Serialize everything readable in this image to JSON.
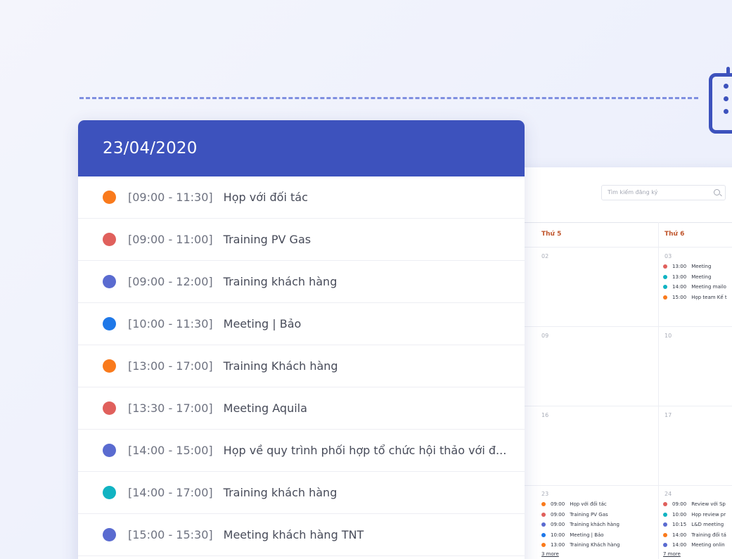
{
  "colors": {
    "primary": "#3d52bd",
    "orange": "#f97a1c",
    "red": "#e0605c",
    "indigo": "#5a6bd0",
    "blue": "#1f78e8",
    "teal": "#11b3c2"
  },
  "agenda": {
    "date": "23/04/2020",
    "items": [
      {
        "time": "[09:00 - 11:30]",
        "title": "Họp với đối tác",
        "color": "#f97a1c"
      },
      {
        "time": "[09:00 - 11:00]",
        "title": "Training PV Gas",
        "color": "#e0605c"
      },
      {
        "time": "[09:00 - 12:00]",
        "title": "Training khách hàng",
        "color": "#5a6bd0"
      },
      {
        "time": "[10:00 - 11:30]",
        "title": "Meeting | Bảo",
        "color": "#1f78e8"
      },
      {
        "time": "[13:00 - 17:00]",
        "title": "Training Khách hàng",
        "color": "#f97a1c"
      },
      {
        "time": "[13:30 - 17:00]",
        "title": "Meeting Aquila",
        "color": "#e0605c"
      },
      {
        "time": "[14:00 - 15:00]",
        "title": "Họp về quy trình phối hợp tổ chức hội thảo với đ...",
        "color": "#5a6bd0"
      },
      {
        "time": "[14:00 - 17:00]",
        "title": "Training khách hàng",
        "color": "#11b3c2"
      },
      {
        "time": "[15:00 - 15:30]",
        "title": "Meeting khách hàng TNT",
        "color": "#5a6bd0"
      }
    ]
  },
  "calendar": {
    "search_placeholder": "Tìm kiếm đăng ký",
    "day_headers": [
      "Thứ 5",
      "Thứ 6"
    ],
    "cells": {
      "r1c1": "02",
      "r1c2": "03",
      "r2c1": "09",
      "r2c2": "10",
      "r3c1": "16",
      "r3c2": "17",
      "r4c1": "23",
      "r4c2": "24"
    },
    "events_03": [
      {
        "time": "13:00",
        "title": "Meeting",
        "color": "#e0605c"
      },
      {
        "time": "13:00",
        "title": "Meeting",
        "color": "#11b3c2"
      },
      {
        "time": "14:00",
        "title": "Meeting mailo",
        "color": "#11b3c2"
      },
      {
        "time": "15:00",
        "title": "Họp team Kế t",
        "color": "#f97a1c"
      }
    ],
    "events_23": [
      {
        "time": "09:00",
        "title": "Họp với đối tác",
        "color": "#f97a1c"
      },
      {
        "time": "09:00",
        "title": "Training PV Gas",
        "color": "#e0605c"
      },
      {
        "time": "09:00",
        "title": "Training khách hàng",
        "color": "#5a6bd0"
      },
      {
        "time": "10:00",
        "title": "Meeting | Bảo",
        "color": "#1f78e8"
      },
      {
        "time": "13:00",
        "title": "Training Khách hàng",
        "color": "#f97a1c"
      }
    ],
    "events_24": [
      {
        "time": "09:00",
        "title": "Review với Sp",
        "color": "#e0605c"
      },
      {
        "time": "10:00",
        "title": "Họp review pr",
        "color": "#11b3c2"
      },
      {
        "time": "10:15",
        "title": "L&D meeting",
        "color": "#5a6bd0"
      },
      {
        "time": "14:00",
        "title": "Training đối tá",
        "color": "#f97a1c"
      },
      {
        "time": "14:00",
        "title": "Meeting onlin",
        "color": "#5a6bd0"
      }
    ],
    "more_23": "3 more",
    "more_24": "7 more"
  }
}
